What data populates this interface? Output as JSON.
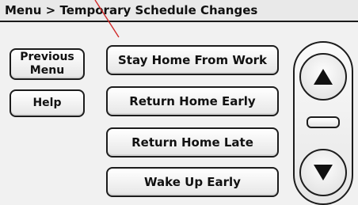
{
  "header": {
    "title": "Menu > Temporary Schedule Changes"
  },
  "side_buttons": {
    "previous_menu": "Previous\nMenu",
    "help": "Help"
  },
  "menu_items": [
    "Stay Home From Work",
    "Return Home Early",
    "Return Home Late",
    "Wake Up Early"
  ],
  "scroll": {
    "up_icon": "triangle-up-icon",
    "down_icon": "triangle-down-icon"
  },
  "colors": {
    "outline": "#1c1c1c",
    "background": "#f1f1f1",
    "annotation_line": "#d02a2a"
  }
}
